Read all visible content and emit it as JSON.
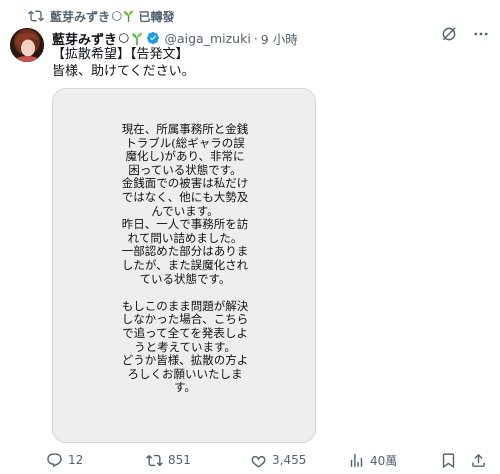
{
  "repost": {
    "label": "已轉發",
    "user": "藍芽みずき",
    "moon": "🌕"
  },
  "author": {
    "name": "藍芽みずき",
    "moon": "🌕",
    "handle": "@aiga_mizuki",
    "separator": "·",
    "time": "9 小時"
  },
  "tweet": {
    "line1": "【拡散希望】【告発文】",
    "line2": "皆様、助けてください。"
  },
  "image_card": {
    "text": "現在、所属事務所と金銭\nトラブル(総ギャラの誤\n魔化し)があり、非常に\n困っている状態です。\n金銭面での被害は私だけ\nではなく、他にも大勢及\nんでいます。\n昨日、一人で事務所を訪\nれて問い詰めました。\n一部認めた部分はありま\nしたが、また誤魔化され\nている状態です。\n\nもしこのまま問題が解決\nしなかった場合、こちら\nで追って全てを発表しよ\nうと考えています。\nどうか皆様、拡散の方よ\nろしくお願いいたしま\nす。"
  },
  "actions": {
    "replies": "12",
    "reposts": "851",
    "likes": "3,455",
    "views": "40萬"
  },
  "colors": {
    "accent": "#1d9bf0",
    "muted": "#536471",
    "verified": "#1d9bf0"
  },
  "icons": [
    "retweet-icon",
    "sprout-icon",
    "verified-badge-icon",
    "grok-icon",
    "more-icon",
    "reply-icon",
    "like-icon",
    "views-icon",
    "bookmark-icon",
    "share-icon"
  ]
}
